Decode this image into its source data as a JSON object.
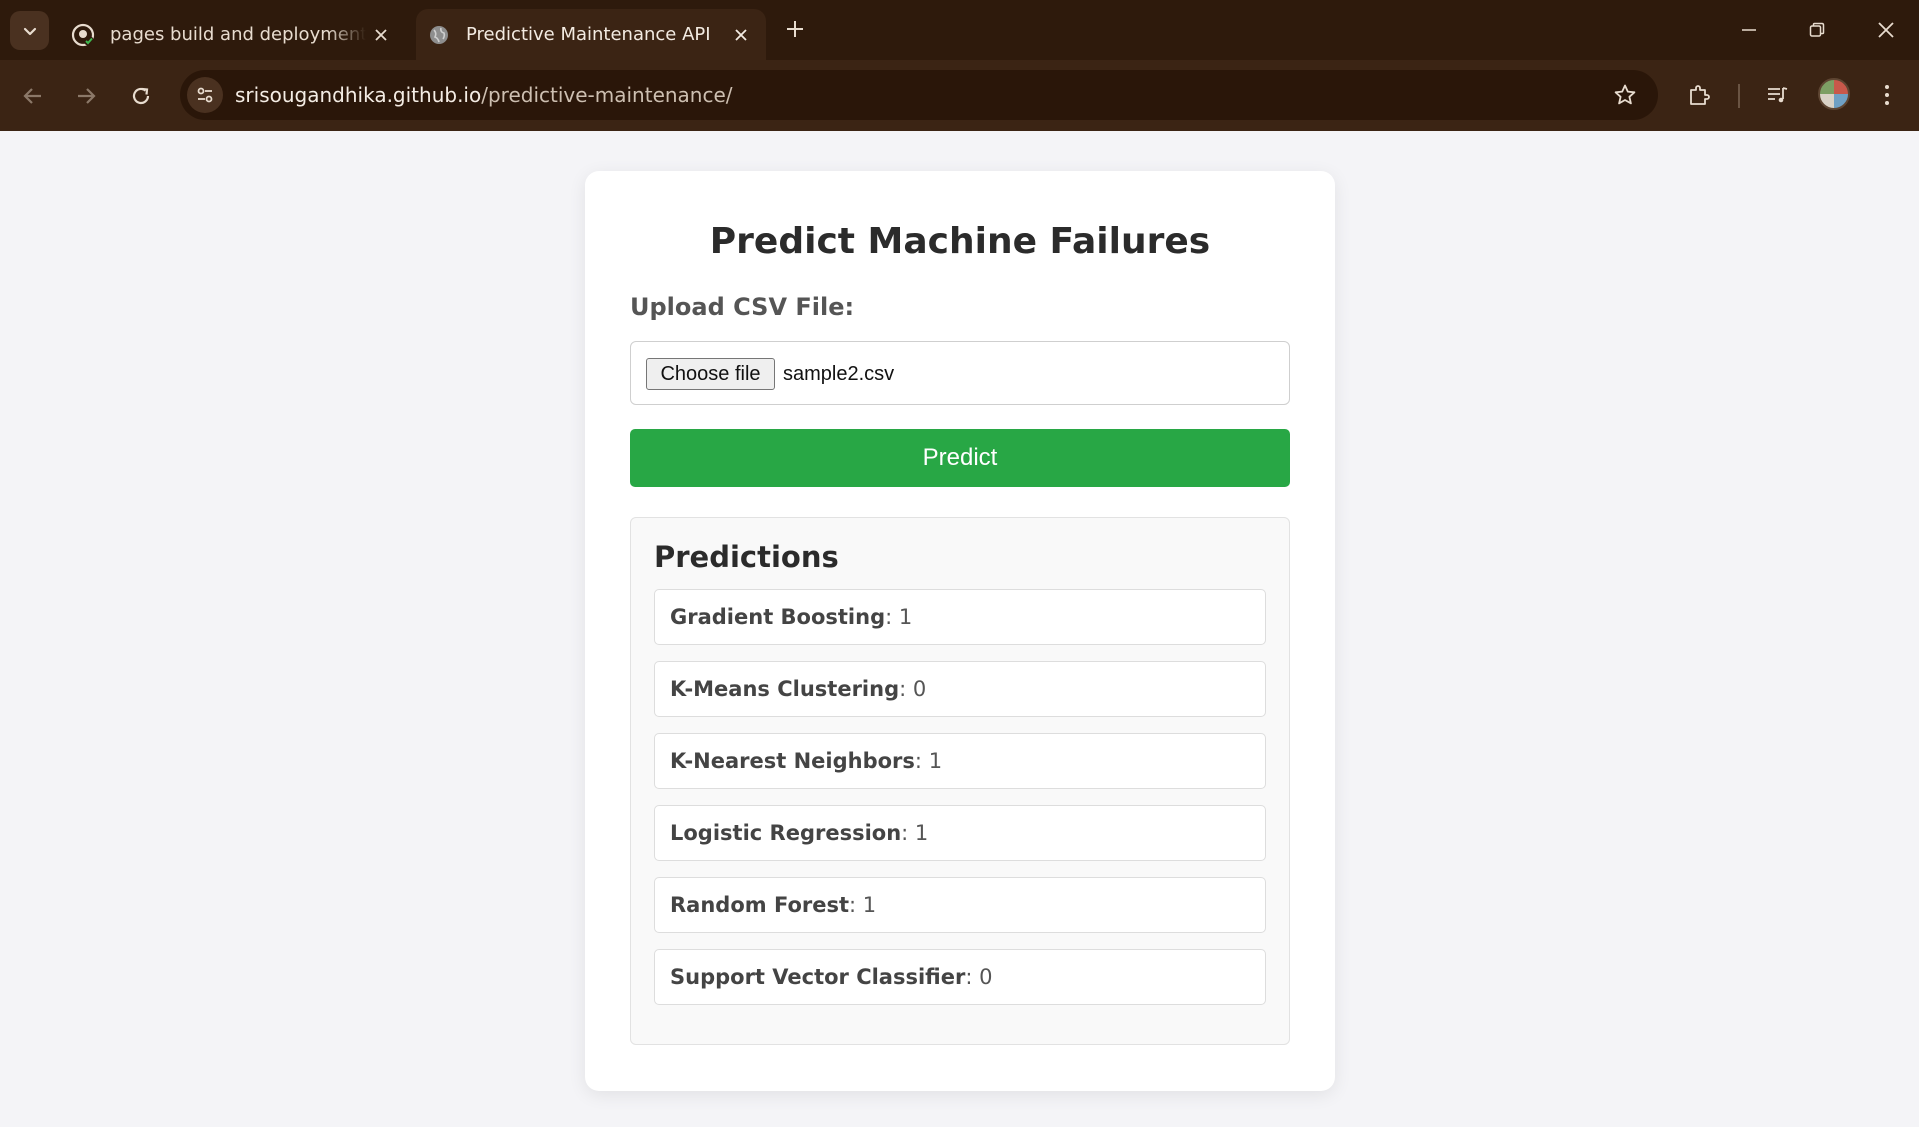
{
  "browser": {
    "tabs": [
      {
        "title": "pages build and deployment · S",
        "active": false,
        "icon": "github-icon"
      },
      {
        "title": "Predictive Maintenance API",
        "active": true,
        "icon": "globe-icon"
      }
    ],
    "url_host": "srisougandhika.github.io",
    "url_path": "/predictive-maintenance/"
  },
  "page": {
    "title": "Predict Machine Failures",
    "upload_label": "Upload CSV File:",
    "choose_file_label": "Choose file",
    "file_name": "sample2.csv",
    "predict_label": "Predict",
    "predictions_title": "Predictions",
    "predictions": [
      {
        "model": "Gradient Boosting",
        "value": "1"
      },
      {
        "model": "K-Means Clustering",
        "value": "0"
      },
      {
        "model": "K-Nearest Neighbors",
        "value": "1"
      },
      {
        "model": "Logistic Regression",
        "value": "1"
      },
      {
        "model": "Random Forest",
        "value": "1"
      },
      {
        "model": "Support Vector Classifier",
        "value": "0"
      }
    ]
  },
  "colors": {
    "predict_button": "#28a745",
    "chrome": "#3b2414"
  }
}
